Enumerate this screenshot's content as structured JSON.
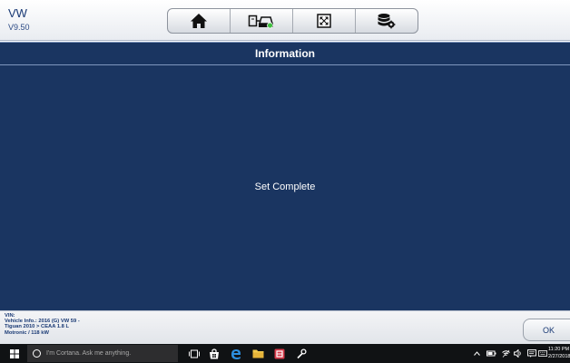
{
  "header": {
    "make": "VW",
    "version": "V9.50",
    "toolbar": [
      {
        "icon": "home-icon",
        "label": "Home"
      },
      {
        "icon": "vehicle-swap-icon",
        "label": "Vehicle swap"
      },
      {
        "icon": "fullscreen-icon",
        "label": "Full screen"
      },
      {
        "icon": "database-settings-icon",
        "label": "Data settings"
      }
    ]
  },
  "title": "Information",
  "message": "Set Complete",
  "footer": {
    "vin_label": "VIN:",
    "vehicle_info_1": "Vehicle Info.: 2016 (G) VW 59 -",
    "vehicle_info_2": "Tiguan 2010 > CEAA 1.8 L",
    "vehicle_info_3": "Motronic / 118 kW",
    "ok_label": "OK"
  },
  "taskbar": {
    "search_placeholder": "I'm Cortana. Ask me anything.",
    "time": "11:20 PM",
    "date": "2/27/2018"
  },
  "colors": {
    "background": "#1a3561",
    "text": "#ffffff",
    "brand": "#1a3a75",
    "taskbar": "#101214"
  }
}
